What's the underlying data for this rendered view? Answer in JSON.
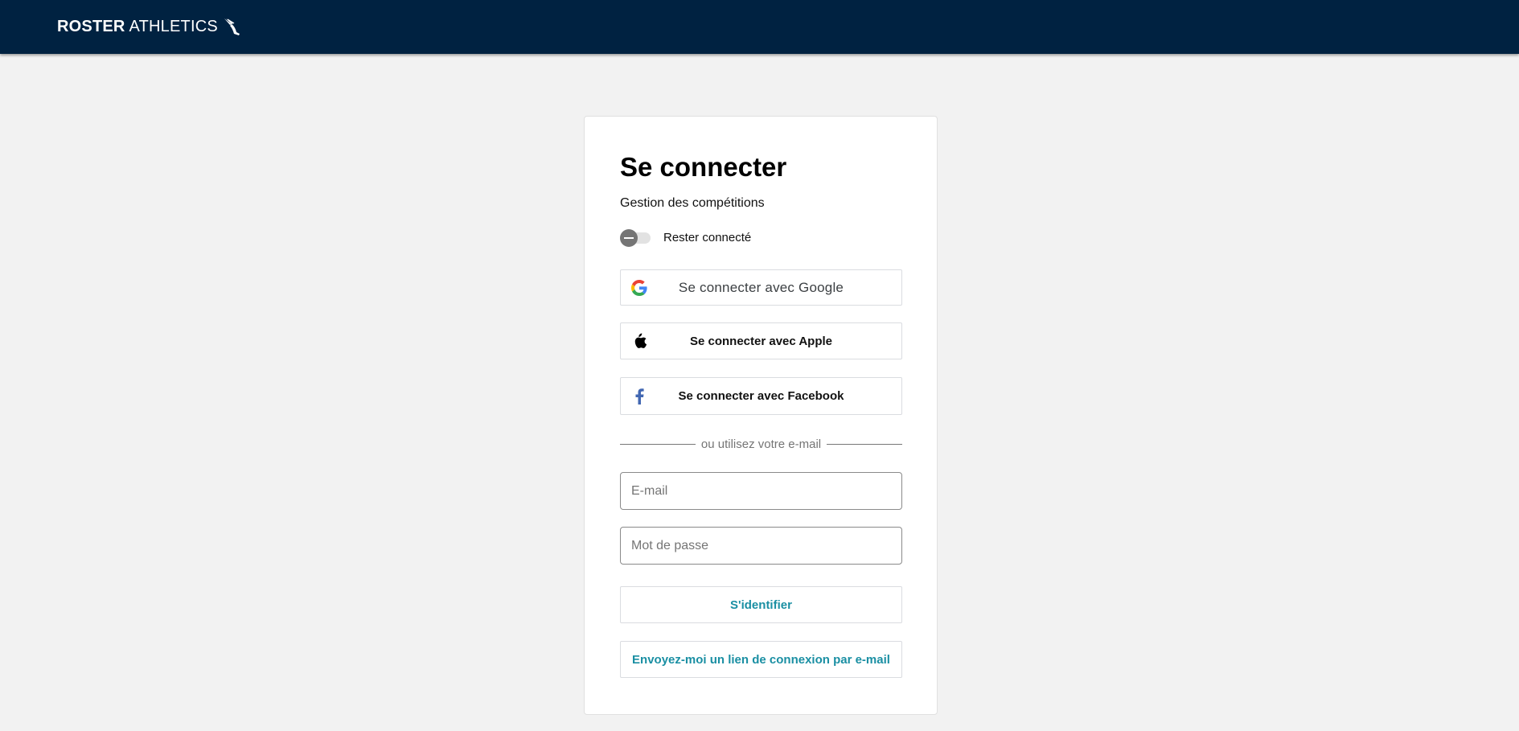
{
  "header": {
    "brand_bold": "ROSTER",
    "brand_regular": "ATHLETICS",
    "logo_icon": "winged-foot-icon",
    "background_color": "#002241"
  },
  "login": {
    "title": "Se connecter",
    "subtitle": "Gestion des compétitions",
    "stay_connected": {
      "label": "Rester connecté",
      "checked": false
    },
    "google_label": "Se connecter avec Google",
    "apple_label": "Se connecter avec Apple",
    "facebook_label": "Se connecter avec Facebook",
    "divider_text": "ou utilisez votre e-mail",
    "email": {
      "placeholder": "E-mail",
      "value": ""
    },
    "password": {
      "placeholder": "Mot de passe",
      "value": ""
    },
    "submit_label": "S'identifier",
    "magic_link_label": "Envoyez-moi un lien de connexion par e-mail",
    "accent_color": "#1a8fa3"
  },
  "icons": [
    "winged-foot-icon",
    "google-icon",
    "apple-icon",
    "facebook-icon"
  ]
}
